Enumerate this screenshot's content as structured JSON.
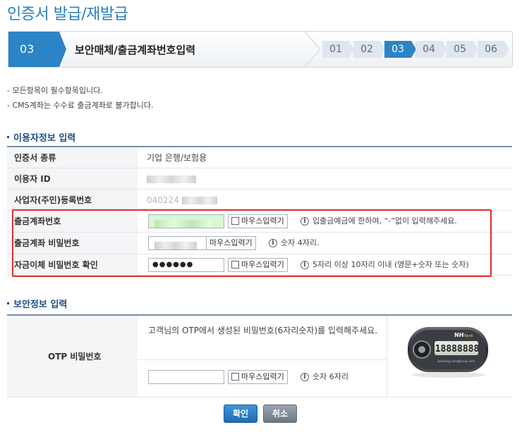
{
  "page": {
    "title": "인증서 발급/재발급"
  },
  "steps": {
    "current_number": "03",
    "current_name": "보안매체/출금계좌번호입력",
    "items": [
      "01",
      "02",
      "03",
      "04",
      "05",
      "06"
    ],
    "active_index": 2,
    "accent_color": "#2b84c6"
  },
  "notices": [
    "- 모든항목이 필수항목입니다.",
    "- CMS계좌는 수수료 출금계좌로 불가합니다."
  ],
  "user_section": {
    "title": "이용자정보 입력",
    "rows": {
      "cert_type": {
        "label": "인증서 종류",
        "value": "기업 은행/보험용"
      },
      "user_id": {
        "label": "이용자 ID"
      },
      "reg_number": {
        "label": "사업자(주민)등록번호",
        "value_prefix": "040224"
      },
      "account_number": {
        "label": "출금계좌번호",
        "mouse_label": "마우스입력기",
        "hint": "입출금예금에 한하여, “-”없이 입력해주세요."
      },
      "account_password": {
        "label": "출금계좌 비밀번호",
        "mouse_label": "마우스입력기",
        "hint": "숫자 4자리."
      },
      "transfer_password": {
        "label": "자금이체 비밀번호 확인",
        "value": "●●●●●●",
        "mouse_label": "마우스입력기",
        "hint": "5자리 이상 10자리 이내 (영문+숫자 또는 숫자)"
      }
    }
  },
  "security_section": {
    "title": "보안정보 입력",
    "otp_label": "OTP 비밀번호",
    "otp_description": "고객님의 OTP에서 생성된 비밀번호(6자리숫자)를 입력해주세요.",
    "mouse_label": "마우스입력기",
    "hint": "숫자 6자리",
    "device": {
      "brand": "NH",
      "brand_sub": "Bank",
      "display": "18888888",
      "url": "banking.nonghyup.com"
    }
  },
  "buttons": {
    "ok": "확인",
    "cancel": "취소"
  },
  "icons": {
    "info": "i"
  },
  "colors": {
    "highlight": "#e02d2d",
    "title": "#2a7fc0",
    "section": "#1e4f86"
  }
}
